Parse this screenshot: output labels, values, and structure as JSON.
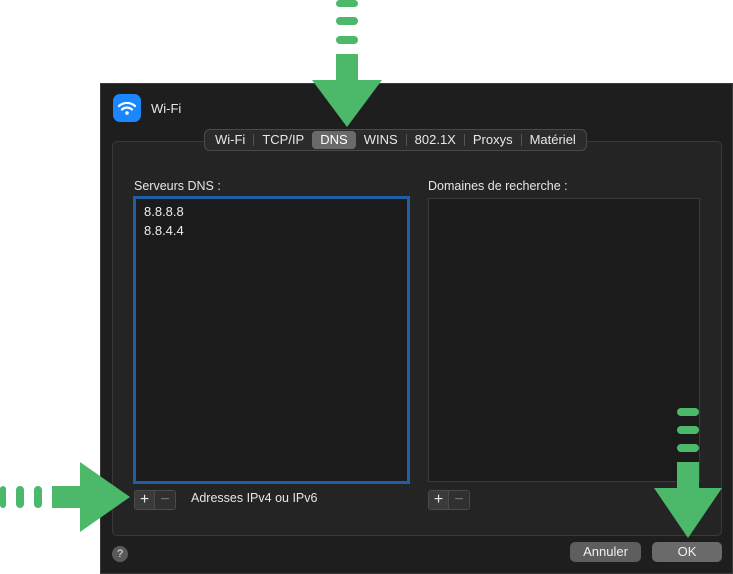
{
  "window": {
    "title": "Wi-Fi",
    "icon": "wifi-icon"
  },
  "tabs": [
    {
      "label": "Wi-Fi",
      "active": false
    },
    {
      "label": "TCP/IP",
      "active": false
    },
    {
      "label": "DNS",
      "active": true
    },
    {
      "label": "WINS",
      "active": false
    },
    {
      "label": "802.1X",
      "active": false
    },
    {
      "label": "Proxys",
      "active": false
    },
    {
      "label": "Matériel",
      "active": false
    }
  ],
  "dns_servers": {
    "label": "Serveurs DNS :",
    "items": [
      "8.8.8.8",
      "8.8.4.4"
    ],
    "hint": "Adresses IPv4 ou IPv6",
    "add_label": "+",
    "remove_label": "−"
  },
  "search_domains": {
    "label": "Domaines de recherche :",
    "items": [],
    "add_label": "+",
    "remove_label": "−"
  },
  "footer": {
    "help_label": "?",
    "cancel_label": "Annuler",
    "ok_label": "OK"
  },
  "colors": {
    "annotation_arrow": "#4cb86a",
    "dialog_background": "#1e1e1e",
    "focus_ring": "#1e5fa8"
  }
}
